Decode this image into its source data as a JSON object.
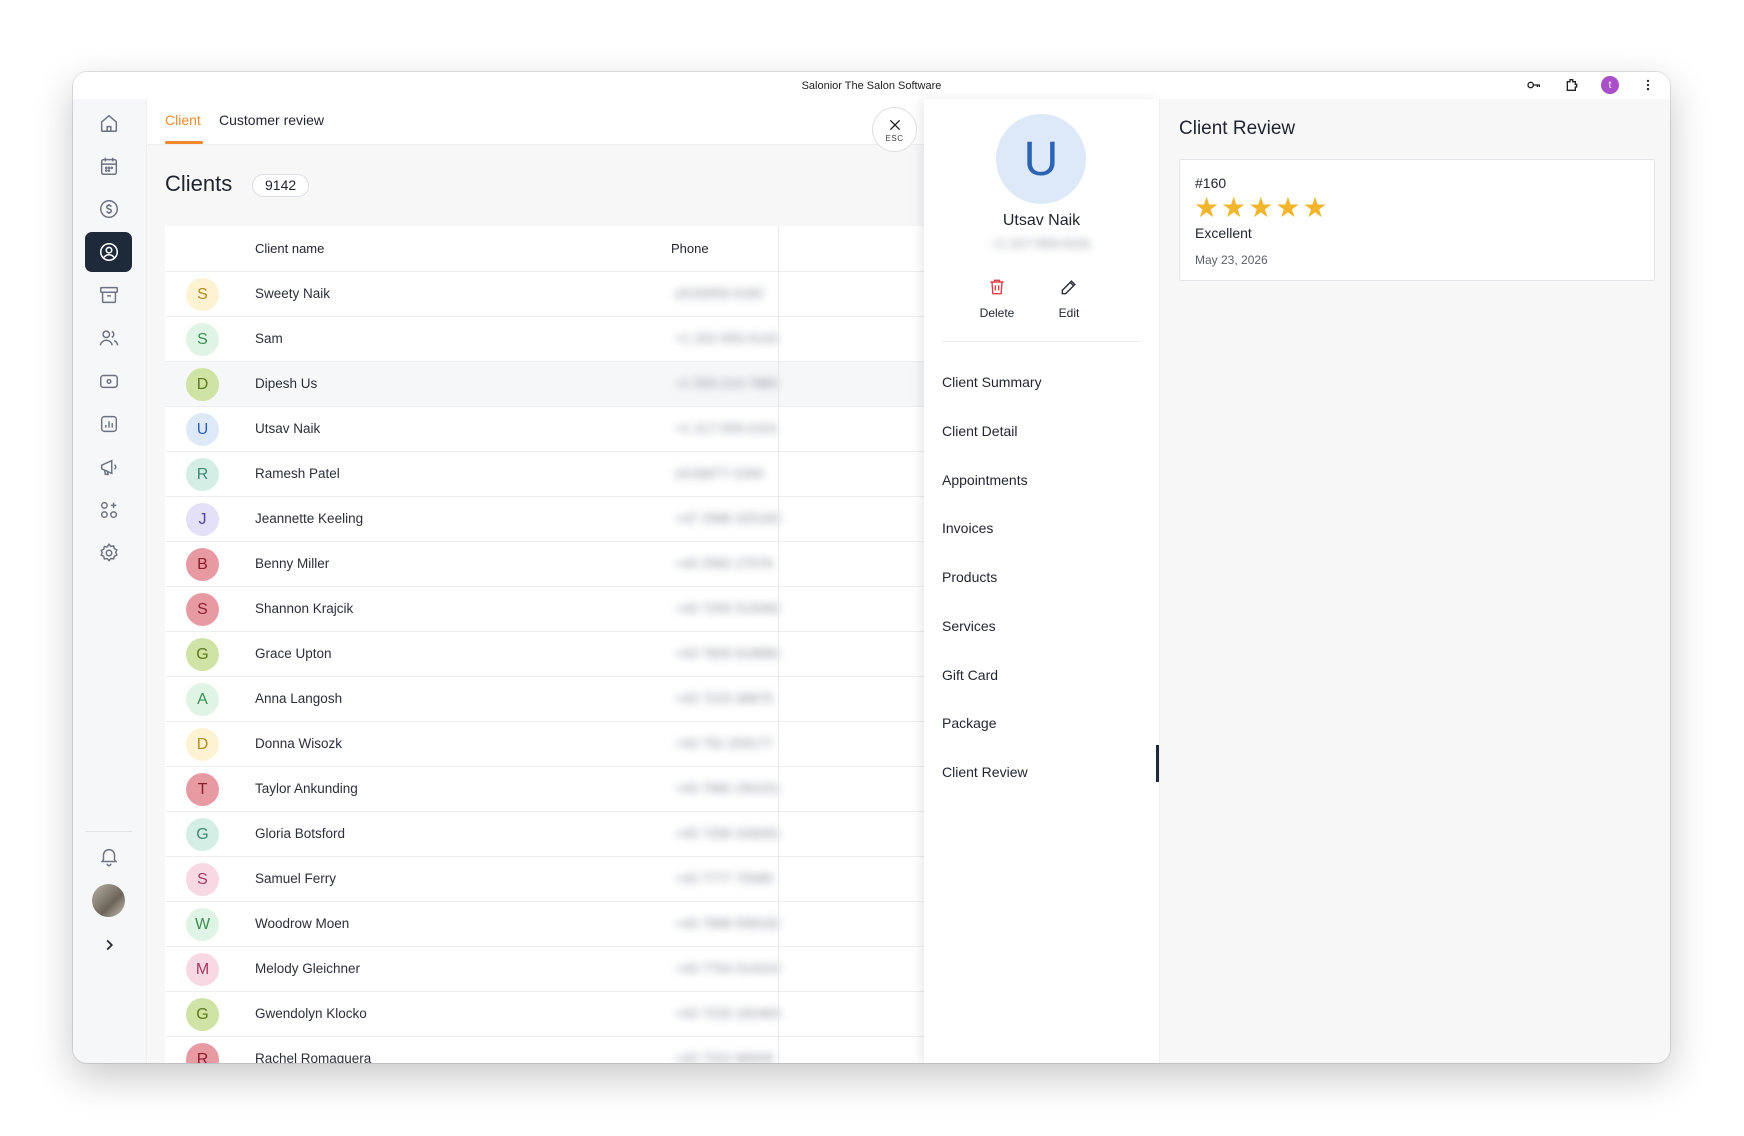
{
  "app": {
    "title": "Salonior The Salon Software",
    "profile_initial": "t",
    "accent": "#f08a2c",
    "nav_active_bg": "#1e2a3a"
  },
  "sidebar": {
    "items": [
      {
        "icon": "home-icon"
      },
      {
        "icon": "calendar-icon"
      },
      {
        "icon": "dollar-icon"
      },
      {
        "icon": "user-circle-icon"
      },
      {
        "icon": "archive-icon"
      },
      {
        "icon": "users-icon"
      },
      {
        "icon": "cash-icon"
      },
      {
        "icon": "chart-icon"
      },
      {
        "icon": "megaphone-icon"
      },
      {
        "icon": "apps-add-icon"
      },
      {
        "icon": "gear-icon"
      }
    ],
    "bottom": [
      {
        "icon": "bell-icon"
      },
      {
        "icon": "avatar"
      },
      {
        "icon": "chevron-right-icon"
      }
    ]
  },
  "tabs": [
    {
      "label": "Client",
      "active": true
    },
    {
      "label": "Customer review",
      "active": false
    }
  ],
  "esc": {
    "label": "ESC"
  },
  "clients": {
    "title": "Clients",
    "count": "9142",
    "columns": {
      "name": "Client name",
      "phone": "Phone"
    },
    "rows": [
      {
        "initial": "S",
        "name": "Sweety Naik",
        "phone": "(419)555-0182",
        "bg": "#fdf3d2",
        "fg": "#b48a1c"
      },
      {
        "initial": "S",
        "name": "Sam",
        "phone": "+1 202-555-0143",
        "bg": "#dff4e4",
        "fg": "#3b8f55"
      },
      {
        "initial": "D",
        "name": "Dipesh Us",
        "phone": "+1 555-210-7880",
        "bg": "#cfe3a4",
        "fg": "#5a7a1c"
      },
      {
        "initial": "U",
        "name": "Utsav Naik",
        "phone": "+1 217-555-0101",
        "bg": "#dde9f8",
        "fg": "#2d63b3"
      },
      {
        "initial": "R",
        "name": "Ramesh Patel",
        "phone": "(419)677-2264",
        "bg": "#d4eee6",
        "fg": "#3d8a73"
      },
      {
        "initial": "J",
        "name": "Jeannette Keeling",
        "phone": "+47 2566 325183",
        "bg": "#e3e0f7",
        "fg": "#4f43a3"
      },
      {
        "initial": "B",
        "name": "Benny Miller",
        "phone": "+43 2562 27076",
        "bg": "#e89aa3",
        "fg": "#8a1f2c"
      },
      {
        "initial": "S",
        "name": "Shannon Krajcik",
        "phone": "+43 7255 515082",
        "bg": "#e89aa3",
        "fg": "#8a1f2c"
      },
      {
        "initial": "G",
        "name": "Grace Upton",
        "phone": "+43 7826 918882",
        "bg": "#cfe3a4",
        "fg": "#5a7a1c"
      },
      {
        "initial": "A",
        "name": "Anna Langosh",
        "phone": "+43 7223 36875",
        "bg": "#dff4e4",
        "fg": "#3b8f55"
      },
      {
        "initial": "D",
        "name": "Donna Wisozk",
        "phone": "+43 752 259177",
        "bg": "#fdf3d2",
        "fg": "#b48a1c"
      },
      {
        "initial": "T",
        "name": "Taylor Ankunding",
        "phone": "+43 7982 250151",
        "bg": "#e89aa3",
        "fg": "#8a1f2c"
      },
      {
        "initial": "G",
        "name": "Gloria Botsford",
        "phone": "+43 7256 326091",
        "bg": "#d4eee6",
        "fg": "#3d8a73"
      },
      {
        "initial": "S",
        "name": "Samuel Ferry",
        "phone": "+43 7777 75065",
        "bg": "#f8d8e3",
        "fg": "#a33a63"
      },
      {
        "initial": "W",
        "name": "Woodrow Moen",
        "phone": "+43 7968 558182",
        "bg": "#dff4e4",
        "fg": "#3b8f55"
      },
      {
        "initial": "M",
        "name": "Melody Gleichner",
        "phone": "+43 7754 014310",
        "bg": "#f8d8e3",
        "fg": "#a33a63"
      },
      {
        "initial": "G",
        "name": "Gwendolyn Klocko",
        "phone": "+43 7233 182463",
        "bg": "#cfe3a4",
        "fg": "#5a7a1c"
      },
      {
        "initial": "R",
        "name": "Rachel Romaguera",
        "phone": "+43 7322 88009",
        "bg": "#e89aa3",
        "fg": "#8a1f2c"
      }
    ]
  },
  "detail": {
    "initial": "U",
    "name": "Utsav Naik",
    "phone": "+1 217-555-0101",
    "actions": {
      "delete": "Delete",
      "edit": "Edit"
    },
    "menu": [
      "Client Summary",
      "Client Detail",
      "Appointments",
      "Invoices",
      "Products",
      "Services",
      "Gift Card",
      "Package",
      "Client Review"
    ],
    "active_menu": "Client Review"
  },
  "review": {
    "title": "Client Review",
    "id": "#160",
    "rating": 5,
    "rating_max": 5,
    "label": "Excellent",
    "date": "May 23, 2026",
    "star_color": "#f2b52e"
  }
}
